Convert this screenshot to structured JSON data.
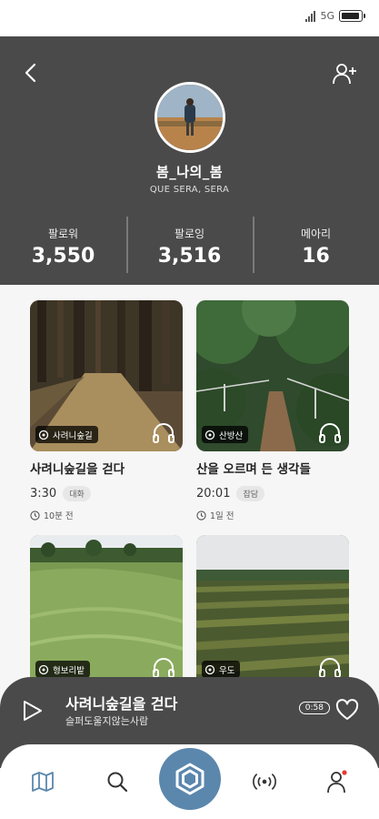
{
  "status": {
    "network": "5G"
  },
  "profile": {
    "name": "봄_나의_봄",
    "subtitle": "QUE SERA, SERA",
    "stats": [
      {
        "label": "팔로워",
        "value": "3,550"
      },
      {
        "label": "팔로잉",
        "value": "3,516"
      },
      {
        "label": "메아리",
        "value": "16"
      }
    ]
  },
  "cards": [
    {
      "tag": "사려니숲길",
      "title": "사려니숲길을 걷다",
      "duration": "3:30",
      "category": "대화",
      "ago": "10분 전"
    },
    {
      "tag": "산방산",
      "title": "산을 오르며 든 생각들",
      "duration": "20:01",
      "category": "잡담",
      "ago": "1일 전"
    },
    {
      "tag": "형보리밭",
      "title": "",
      "duration": "",
      "category": "",
      "ago": ""
    },
    {
      "tag": "우도",
      "title": "",
      "duration": "",
      "category": "",
      "ago": ""
    }
  ],
  "player": {
    "title": "사려니숲길을 걷다",
    "artist": "슬퍼도울지않는사람",
    "time": "0:58"
  },
  "icons": {
    "back": "chevron-left-icon",
    "add_user": "add-user-icon",
    "headphones": "headphones-icon",
    "play": "play-icon",
    "heart": "heart-icon",
    "map": "map-icon",
    "search": "search-icon",
    "record": "hexagon-record-icon",
    "broadcast": "broadcast-icon",
    "profile": "user-icon"
  },
  "colors": {
    "header_bg": "#4a4a4a",
    "accent": "#5b87ad",
    "notification": "#e53935"
  }
}
